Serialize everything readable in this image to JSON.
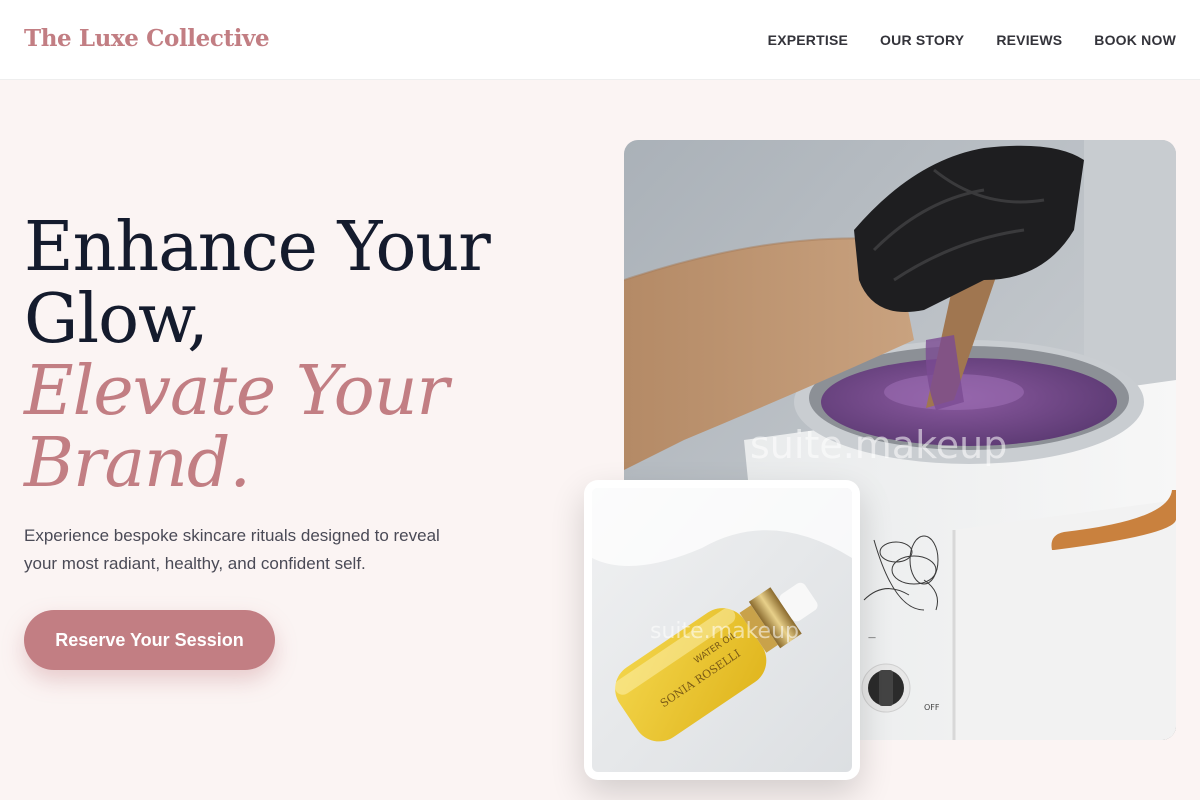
{
  "nav": {
    "brand": "The Luxe Collective",
    "links": [
      "EXPERTISE",
      "OUR STORY",
      "REVIEWS",
      "BOOK NOW"
    ]
  },
  "hero": {
    "title_line1": "Enhance Your",
    "title_line2": "Glow,",
    "title_line3": "Elevate Your",
    "title_line4": "Brand.",
    "description": "Experience bespoke skincare rituals designed to reveal your most radiant, healthy, and confident self.",
    "cta_label": "Reserve Your Session"
  },
  "images": {
    "main_watermark": "suite.makeup",
    "small_watermark": "suite.makeup",
    "bottle_label_1": "WATER OIL",
    "bottle_label_2": "SONIA ROSELLI"
  },
  "colors": {
    "accent": "#c27e83",
    "heading": "#141b2d",
    "background": "#fbf4f3"
  }
}
